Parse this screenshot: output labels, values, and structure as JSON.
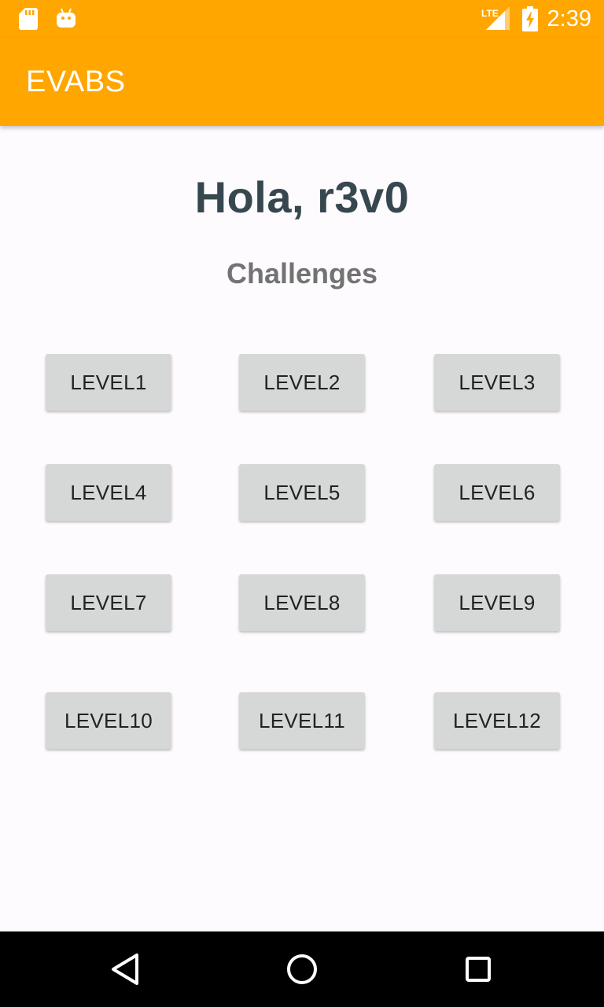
{
  "status_bar": {
    "time": "2:39",
    "network_label": "LTE",
    "icons": [
      "sd-card-icon",
      "android-debug-icon",
      "lte-signal-icon",
      "battery-charging-icon"
    ]
  },
  "app_bar": {
    "title": "EVABS",
    "color": "#ffa600"
  },
  "main": {
    "greeting": "Hola, r3v0",
    "subtitle": "Challenges",
    "levels": [
      "LEVEL1",
      "LEVEL2",
      "LEVEL3",
      "LEVEL4",
      "LEVEL5",
      "LEVEL6",
      "LEVEL7",
      "LEVEL8",
      "LEVEL9",
      "LEVEL10",
      "LEVEL11",
      "LEVEL12"
    ]
  },
  "nav_bar": {
    "icons": [
      "back-icon",
      "home-icon",
      "recents-icon"
    ]
  }
}
